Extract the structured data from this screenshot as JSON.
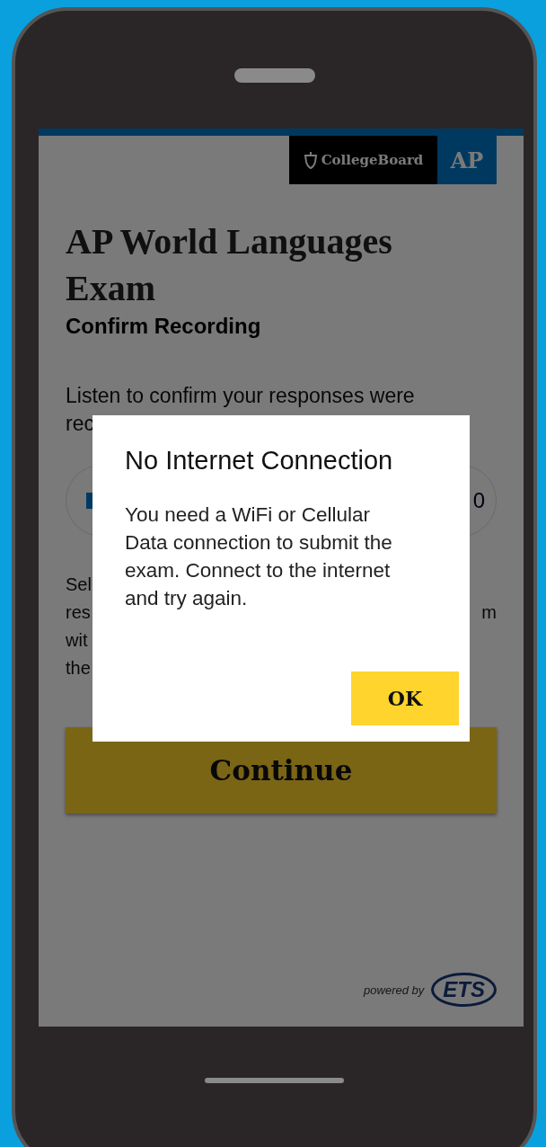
{
  "header": {
    "logo_text": "CollegeBoard",
    "badge": "AP"
  },
  "title": "AP World Languages Exam",
  "subtitle": "Confirm Recording",
  "instructions": [
    "Listen to confirm your responses were",
    "rec"
  ],
  "player": {
    "time": "0"
  },
  "instructions_2": [
    {
      "left": "Sel"
    },
    {
      "left": "res",
      "right": "m"
    },
    {
      "left": "wit"
    },
    {
      "left": "the"
    }
  ],
  "continue_button": "Continue",
  "footer": {
    "powered_by": "powered by",
    "logo": "ETS"
  },
  "dialog": {
    "title": "No Internet Connection",
    "message": "You need a WiFi or Cellular Data connection to submit the exam. Connect to the internet and try again.",
    "button": "OK"
  }
}
